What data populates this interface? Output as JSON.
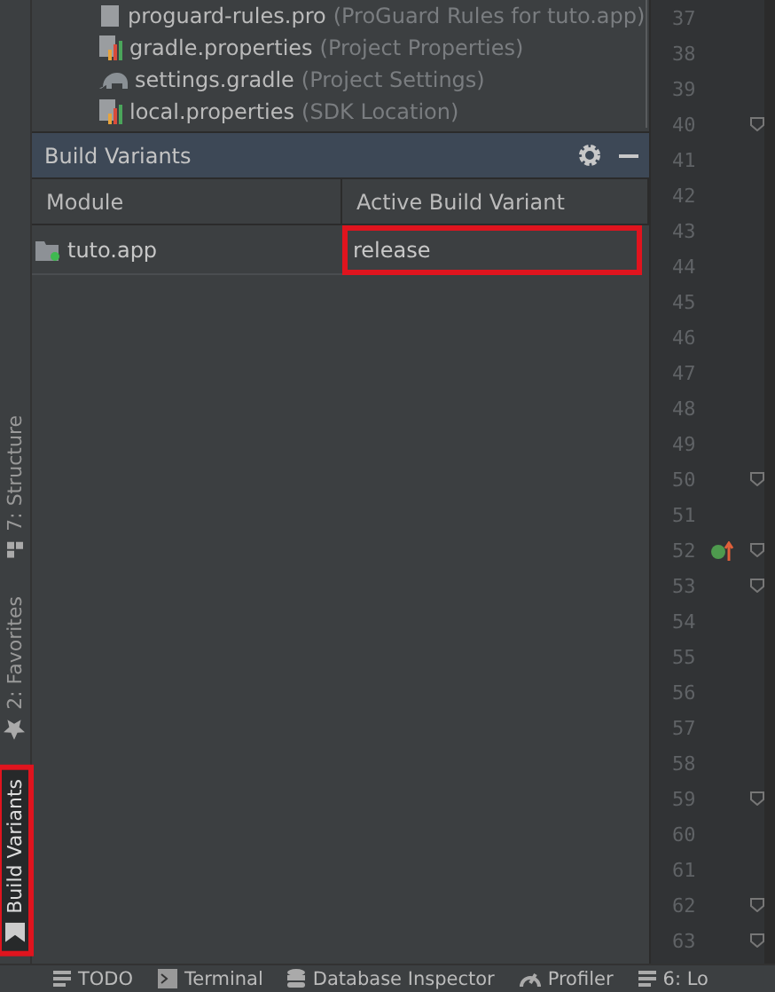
{
  "project_tree": [
    {
      "name": "proguard-rules.pro",
      "hint": "(ProGuard Rules for tuto.app)",
      "kind": "file"
    },
    {
      "name": "gradle.properties",
      "hint": "(Project Properties)",
      "kind": "properties"
    },
    {
      "name": "settings.gradle",
      "hint": "(Project Settings)",
      "kind": "gradle"
    },
    {
      "name": "local.properties",
      "hint": "(SDK Location)",
      "kind": "properties"
    }
  ],
  "tool_window": {
    "title": "Build Variants",
    "columns": [
      "Module",
      "Active Build Variant"
    ],
    "rows": [
      {
        "module": "tuto.app",
        "variant": "release",
        "highlighted": true
      }
    ]
  },
  "side_tabs": [
    {
      "label": "7: Structure",
      "kind": "structure",
      "selected": false,
      "highlighted": false
    },
    {
      "label": "2: Favorites",
      "kind": "favorites",
      "selected": false,
      "highlighted": false
    },
    {
      "label": "Build Variants",
      "kind": "variants",
      "selected": true,
      "highlighted": true
    }
  ],
  "line_numbers": [
    {
      "n": "37",
      "fold": false
    },
    {
      "n": "38",
      "fold": false
    },
    {
      "n": "39",
      "fold": false
    },
    {
      "n": "40",
      "fold": true
    },
    {
      "n": "41",
      "fold": false
    },
    {
      "n": "42",
      "fold": false
    },
    {
      "n": "43",
      "fold": false
    },
    {
      "n": "44",
      "fold": false
    },
    {
      "n": "45",
      "fold": false
    },
    {
      "n": "46",
      "fold": false
    },
    {
      "n": "47",
      "fold": false
    },
    {
      "n": "48",
      "fold": false
    },
    {
      "n": "49",
      "fold": false
    },
    {
      "n": "50",
      "fold": true
    },
    {
      "n": "51",
      "fold": false
    },
    {
      "n": "52",
      "fold": true,
      "marker": true
    },
    {
      "n": "53",
      "fold": true
    },
    {
      "n": "54",
      "fold": false
    },
    {
      "n": "55",
      "fold": false
    },
    {
      "n": "56",
      "fold": false
    },
    {
      "n": "57",
      "fold": false
    },
    {
      "n": "58",
      "fold": false
    },
    {
      "n": "59",
      "fold": true
    },
    {
      "n": "60",
      "fold": false
    },
    {
      "n": "61",
      "fold": false
    },
    {
      "n": "62",
      "fold": true
    },
    {
      "n": "63",
      "fold": true
    }
  ],
  "bottom_tabs": [
    {
      "label": "TODO",
      "kind": "list"
    },
    {
      "label": "Terminal",
      "kind": "terminal"
    },
    {
      "label": "Database Inspector",
      "kind": "database"
    },
    {
      "label": "Profiler",
      "kind": "gauge"
    },
    {
      "label": "6: Lo",
      "kind": "list"
    }
  ]
}
